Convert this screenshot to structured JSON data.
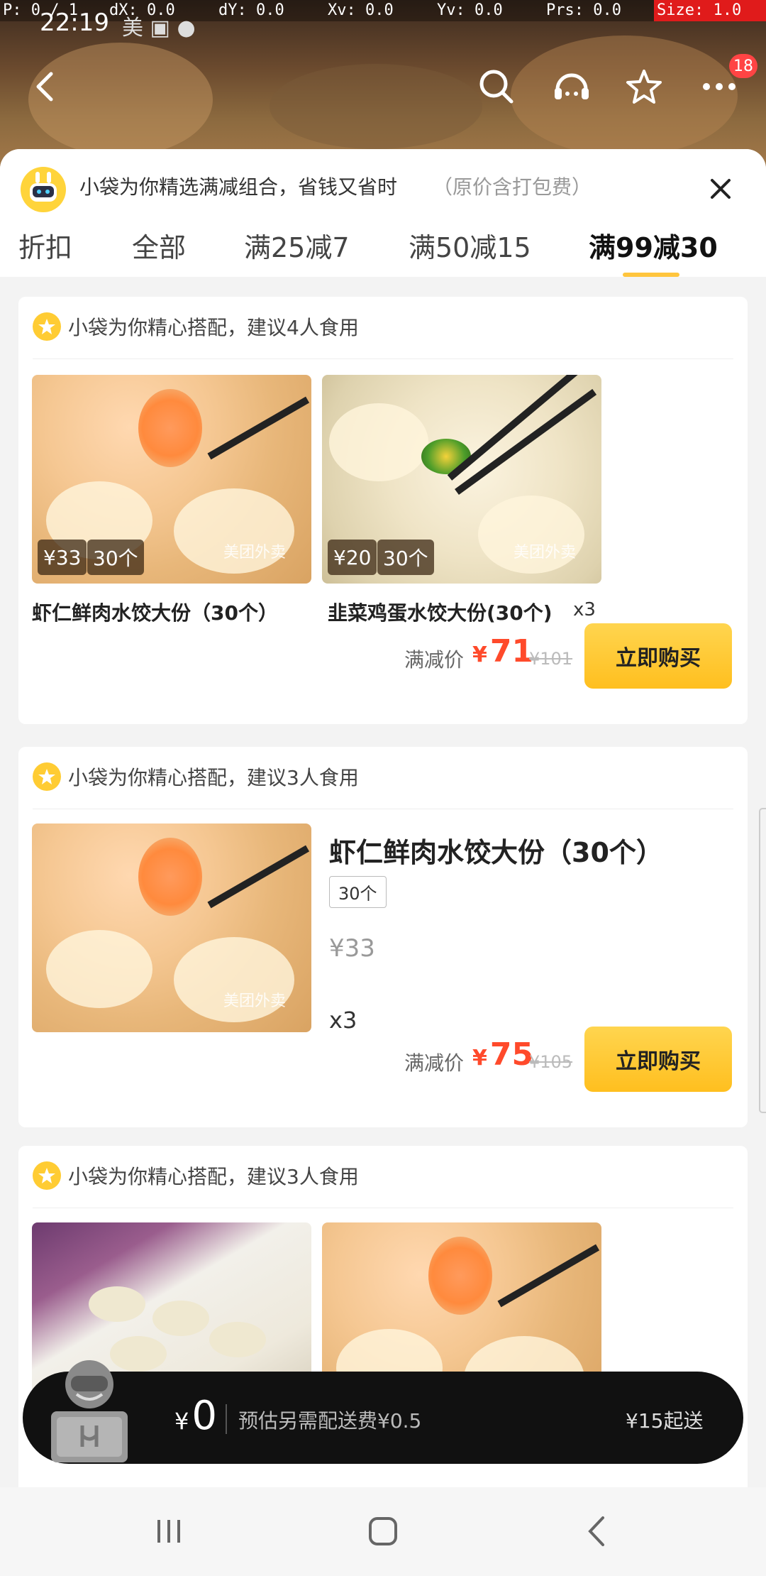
{
  "debug": {
    "p": "P: 0 / 1",
    "dx": "dX: 0.0",
    "dy": "dY: 0.0",
    "xv": "Xv: 0.0",
    "yv": "Yv: 0.0",
    "prs": "Prs: 0.0",
    "size": "Size: 1.0"
  },
  "status": {
    "time": "22:19",
    "carrier": "美"
  },
  "header": {
    "badge_count": "18"
  },
  "promo": {
    "text": "小袋为你精选满减组合，省钱又省时",
    "sub": "（原价含打包费）"
  },
  "tabs": [
    {
      "label": "折扣"
    },
    {
      "label": "全部"
    },
    {
      "label": "满25减7"
    },
    {
      "label": "满50减15"
    },
    {
      "label": "满99减30"
    }
  ],
  "cards": [
    {
      "title": "小袋为你精心搭配，建议4人食用",
      "items": [
        {
          "price": "¥33",
          "count": "30个",
          "name": "虾仁鲜肉水饺大份（30个）",
          "qty": ""
        },
        {
          "price": "¥20",
          "count": "30个",
          "name": "韭菜鸡蛋水饺大份(30个)",
          "qty": "x3"
        }
      ],
      "deal_label": "满减价",
      "deal_price": "71",
      "orig_price": "¥101",
      "buy_label": "立即购买"
    },
    {
      "title": "小袋为你精心搭配，建议3人食用",
      "detail": {
        "name": "虾仁鲜肉水饺大份（30个）",
        "spec": "30个",
        "price": "¥33",
        "qty": "x3"
      },
      "deal_label": "满减价",
      "deal_price": "75",
      "orig_price": "¥105",
      "buy_label": "立即购买"
    },
    {
      "title": "小袋为你精心搭配，建议3人食用"
    }
  ],
  "watermark": "美团外卖",
  "cart": {
    "yen": "¥",
    "amount": "0",
    "fee": "预估另需配送费¥0.5",
    "min": "¥15起送"
  },
  "currency_symbol": "¥",
  "colors": {
    "accent": "#ffc53d",
    "price": "#ff4a2b",
    "cart_bg": "#111111"
  }
}
